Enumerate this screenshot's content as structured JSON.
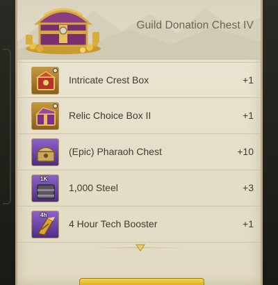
{
  "header": {
    "title": "Guild Donation Chest IV",
    "chest_icon": "treasure-chest"
  },
  "items": [
    {
      "name": "Intricate Crest Box",
      "qty": "+1",
      "icon": "crest-box",
      "frame": "orange",
      "tag": ""
    },
    {
      "name": "Relic Choice Box II",
      "qty": "+1",
      "icon": "relic-box",
      "frame": "orange",
      "tag": ""
    },
    {
      "name": "(Epic)  Pharaoh Chest",
      "qty": "+10",
      "icon": "pharaoh-chest",
      "frame": "purple",
      "tag": ""
    },
    {
      "name": "1,000 Steel",
      "qty": "+3",
      "icon": "steel-crate",
      "frame": "purple",
      "tag": "1K"
    },
    {
      "name": "4 Hour Tech Booster",
      "qty": "+1",
      "icon": "tech-booster",
      "frame": "purple",
      "tag": "4h"
    }
  ],
  "colors": {
    "parchment": "#e6e0cc",
    "text": "#3f3a30",
    "title": "#6a6454",
    "frame_orange": "#b57f30",
    "frame_purple": "#6d45a8",
    "button_gold": "#e2b92a"
  }
}
